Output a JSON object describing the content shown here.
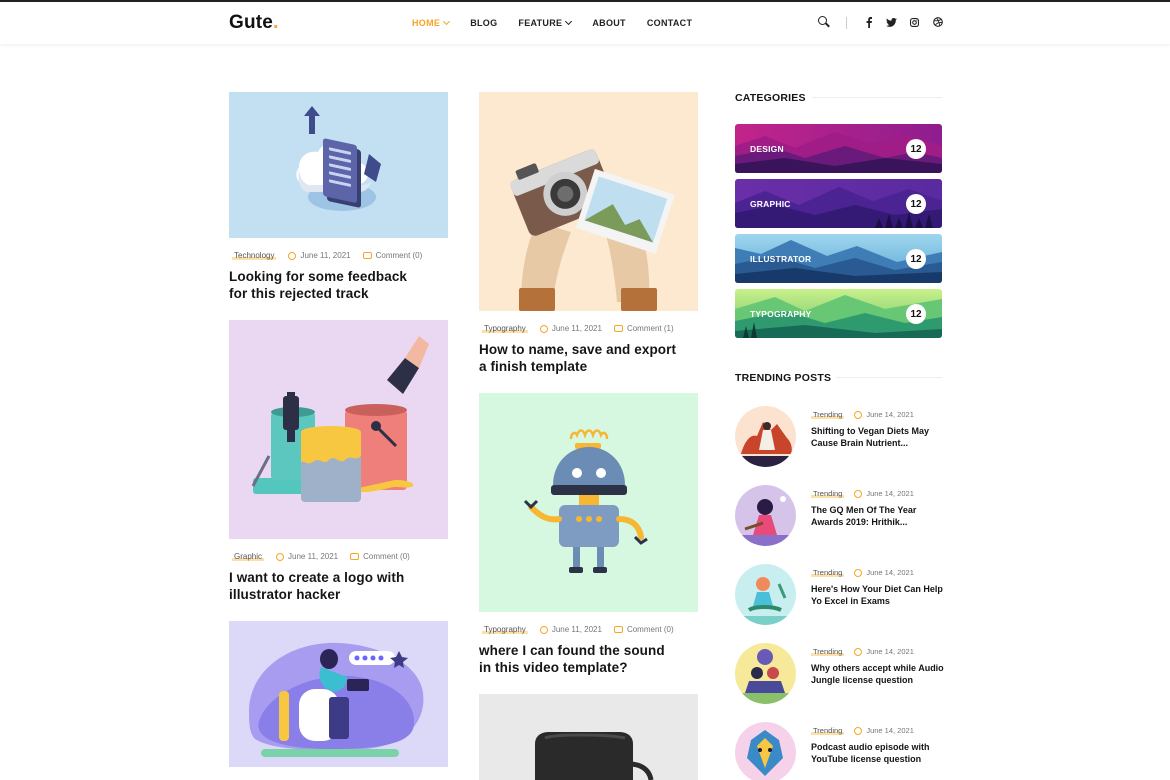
{
  "header": {
    "logo": "Gute",
    "logo_dot": ".",
    "nav": [
      {
        "label": "HOME",
        "active": true,
        "dropdown": true
      },
      {
        "label": "BLOG",
        "active": false,
        "dropdown": false
      },
      {
        "label": "FEATURE",
        "active": false,
        "dropdown": true
      },
      {
        "label": "ABOUT",
        "active": false,
        "dropdown": false
      },
      {
        "label": "CONTACT",
        "active": false,
        "dropdown": false
      }
    ],
    "socials": [
      "f",
      "t",
      "ig",
      "db"
    ]
  },
  "posts": [
    {
      "category": "Technology",
      "date": "June 11, 2021",
      "comments": "Comment (0)",
      "title_1": "Looking for some feedback",
      "title_2": "for this rejected track"
    },
    {
      "category": "Typography",
      "date": "June 11, 2021",
      "comments": "Comment (1)",
      "title_1": "How to name, save and export",
      "title_2": "a finish template"
    },
    {
      "category": "Graphic",
      "date": "June 11, 2021",
      "comments": "Comment (0)",
      "title_1": "I want to create a logo with",
      "title_2": "illustrator hacker"
    },
    {
      "category": "Typography",
      "date": "June 11, 2021",
      "comments": "Comment (0)",
      "title_1": "where I can found the sound",
      "title_2": "in this video template?"
    }
  ],
  "sidebar": {
    "categories_title": "CATEGORIES",
    "categories": [
      {
        "name": "DESIGN",
        "count": "12"
      },
      {
        "name": "GRAPHIC",
        "count": "12"
      },
      {
        "name": "ILLUSTRATOR",
        "count": "12"
      },
      {
        "name": "TYPOGRAPHY",
        "count": "12"
      }
    ],
    "trending_title": "TRENDING POSTS",
    "trending": [
      {
        "category": "Trending",
        "date": "June 14, 2021",
        "title": "Shifting to Vegan Diets May Cause Brain Nutrient..."
      },
      {
        "category": "Trending",
        "date": "June 14, 2021",
        "title": "The GQ Men Of The Year Awards 2019: Hrithik..."
      },
      {
        "category": "Trending",
        "date": "June 14, 2021",
        "title": "Here's How Your Diet Can Help Yo Excel in Exams"
      },
      {
        "category": "Trending",
        "date": "June 14, 2021",
        "title": "Why others accept while Audio Jungle license question"
      },
      {
        "category": "Trending",
        "date": "June 14, 2021",
        "title": "Podcast audio episode with YouTube license question"
      }
    ]
  },
  "colors": {
    "accent": "#f5a623",
    "text": "#151515"
  }
}
